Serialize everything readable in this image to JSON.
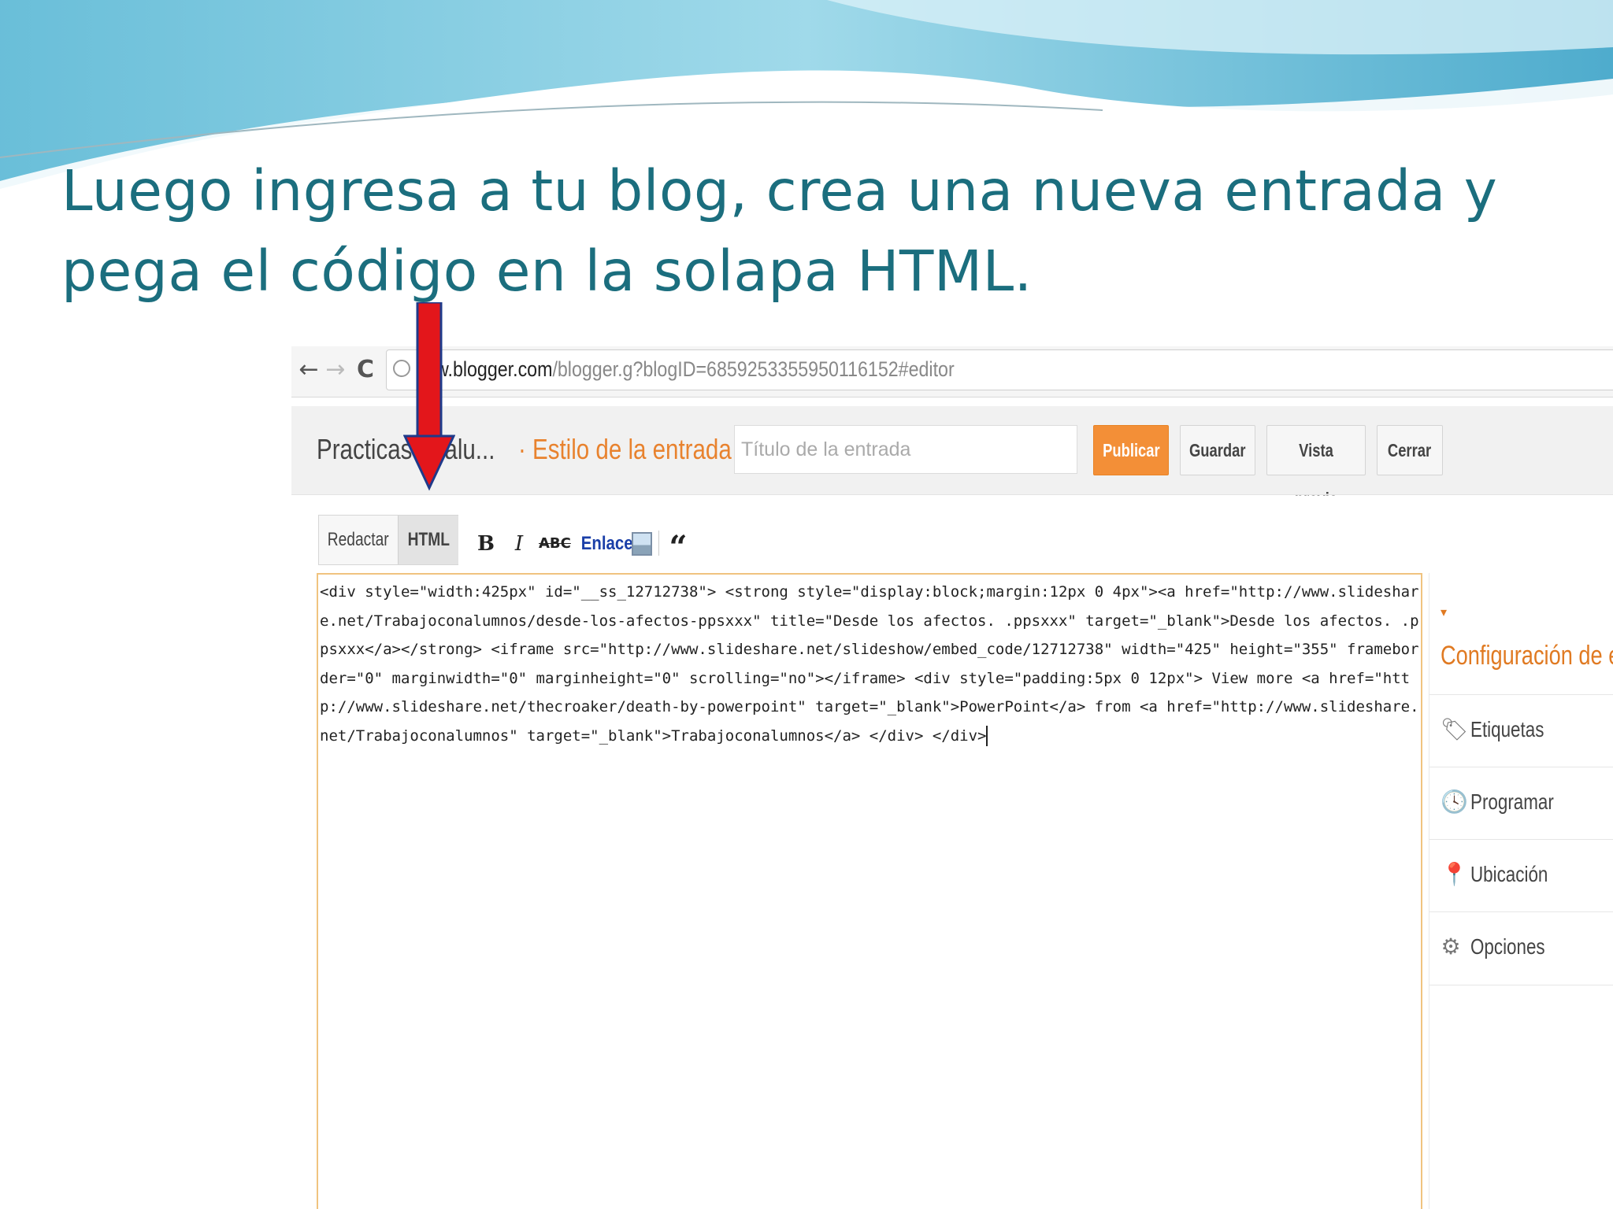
{
  "slide": {
    "title": "Luego ingresa a tu blog, crea una nueva entrada y pega el código en la solapa HTML."
  },
  "browser": {
    "back_label": "←",
    "forward_label": "→",
    "reload_label": "C",
    "url_host": "w.blogger.com",
    "url_path": "/blogger.g?blogID=6859253355950116152#editor"
  },
  "editor": {
    "blog_name": "Practicas ... alu...",
    "post_label": "· Estilo de la entrada",
    "title_placeholder": "Título de la entrada",
    "buttons": {
      "publish": "Publicar",
      "save": "Guardar",
      "preview": "Vista previa",
      "close": "Cerrar"
    },
    "tabs": {
      "compose": "Redactar",
      "html": "HTML"
    },
    "tools": {
      "bold": "B",
      "italic": "I",
      "strike": "ABC",
      "link": "Enlace",
      "quote": "“"
    },
    "code": "<div style=\"width:425px\" id=\"__ss_12712738\"> <strong style=\"display:block;margin:12px 0 4px\"><a href=\"http://www.slideshare.net/Trabajoconalumnos/desde-los-afectos-ppsxxx\" title=\"Desde los afectos. .ppsxxx\" target=\"_blank\">Desde los afectos. .ppsxxx</a></strong> <iframe src=\"http://www.slideshare.net/slideshow/embed_code/12712738\" width=\"425\" height=\"355\" frameborder=\"0\" marginwidth=\"0\" marginheight=\"0\" scrolling=\"no\"></iframe> <div style=\"padding:5px 0 12px\"> View more <a href=\"http://www.slideshare.net/thecroaker/death-by-powerpoint\" target=\"_blank\">PowerPoint</a> from <a href=\"http://www.slideshare.net/Trabajoconalumnos\" target=\"_blank\">Trabajoconalumnos</a> </div> </div>"
  },
  "sidebar": {
    "heading": "Configuración de entradas",
    "items": [
      {
        "label": "Etiquetas",
        "icon": "tag-icon"
      },
      {
        "label": "Programar",
        "icon": "clock-icon"
      },
      {
        "label": "Ubicación",
        "icon": "location-pin-icon"
      },
      {
        "label": "Opciones",
        "icon": "gear-icon"
      }
    ]
  },
  "colors": {
    "title": "#1b6e7e",
    "publish": "#f38f37",
    "accent_orange": "#e07a22",
    "arrow": "#e3161b"
  }
}
